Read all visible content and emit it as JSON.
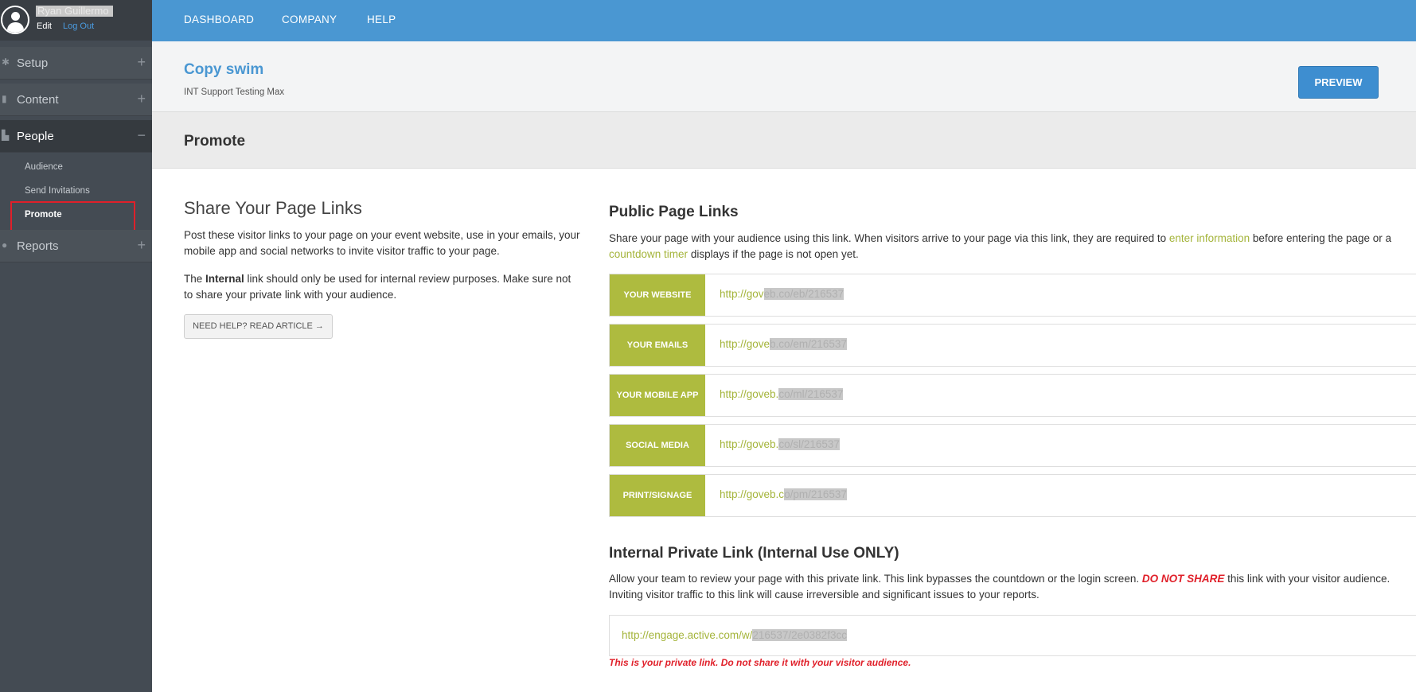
{
  "user": {
    "name": "Ryan Guillermo",
    "edit": "Edit",
    "logout": "Log Out"
  },
  "sidebar": {
    "items": [
      {
        "label": "Setup",
        "icon": "gear-icon",
        "toggle": "+"
      },
      {
        "label": "Content",
        "icon": "document-icon",
        "toggle": "+"
      },
      {
        "label": "People",
        "icon": "people-icon",
        "toggle": "−"
      },
      {
        "label": "Reports",
        "icon": "pie-chart-icon",
        "toggle": "+"
      }
    ],
    "people_sub": [
      "Audience",
      "Send Invitations",
      "Promote"
    ],
    "highlight_color": "#e0202a"
  },
  "topnav": [
    "DASHBOARD",
    "COMPANY",
    "HELP"
  ],
  "header": {
    "title": "Copy swim",
    "subtitle": "INT Support Testing Max",
    "preview": "PREVIEW"
  },
  "section": {
    "title": "Promote"
  },
  "share": {
    "title": "Share Your Page Links",
    "p1": "Post these visitor links to your page on your event website, use in your emails, your mobile app and social networks to invite visitor traffic to your page.",
    "p2_pre": "The ",
    "p2_bold": "Internal",
    "p2_post": " link should only be used for internal review purposes. Make sure not to share your private link with your audience.",
    "help": "NEED HELP? READ ARTICLE →"
  },
  "public": {
    "title": "Public Page Links",
    "desc_pre": "Share your page with your audience using this link. When visitors arrive to your page via this link, they are required to ",
    "desc_link1": "enter information",
    "desc_mid": " before entering the page or a ",
    "desc_link2": "countdown timer",
    "desc_post": " displays if the page is not open yet.",
    "rows": [
      {
        "label": "YOUR WEBSITE",
        "url_visible": "http://gov",
        "url_hidden": "eb.co/eb/216537"
      },
      {
        "label": "YOUR EMAILS",
        "url_visible": "http://gove",
        "url_hidden": "b.co/em/216537"
      },
      {
        "label": "YOUR MOBILE APP",
        "url_visible": "http://goveb.",
        "url_hidden": "co/ml/216537"
      },
      {
        "label": "SOCIAL MEDIA",
        "url_visible": "http://goveb.",
        "url_hidden": "co/sl/216537"
      },
      {
        "label": "PRINT/SIGNAGE",
        "url_visible": "http://goveb.c",
        "url_hidden": "o/pm/216537"
      }
    ]
  },
  "private": {
    "title": "Internal Private Link (Internal Use ONLY)",
    "desc_pre": "Allow your team to review your page with this private link. This link bypasses the countdown or the login screen. ",
    "desc_warn": "DO NOT SHARE",
    "desc_post": " this link with your visitor audience. Inviting visitor traffic to this link will cause irreversible and significant issues to your reports.",
    "url_visible": "http://engage.active.com/w/",
    "url_hidden": "216537/2e0382f3cc",
    "note": "This is your private link. Do not share it with your visitor audience."
  },
  "colors": {
    "topbar": "#4a97d2",
    "accent_green": "#aebb3f",
    "link_green": "#a4b43a",
    "sidebar": "#444b53"
  }
}
